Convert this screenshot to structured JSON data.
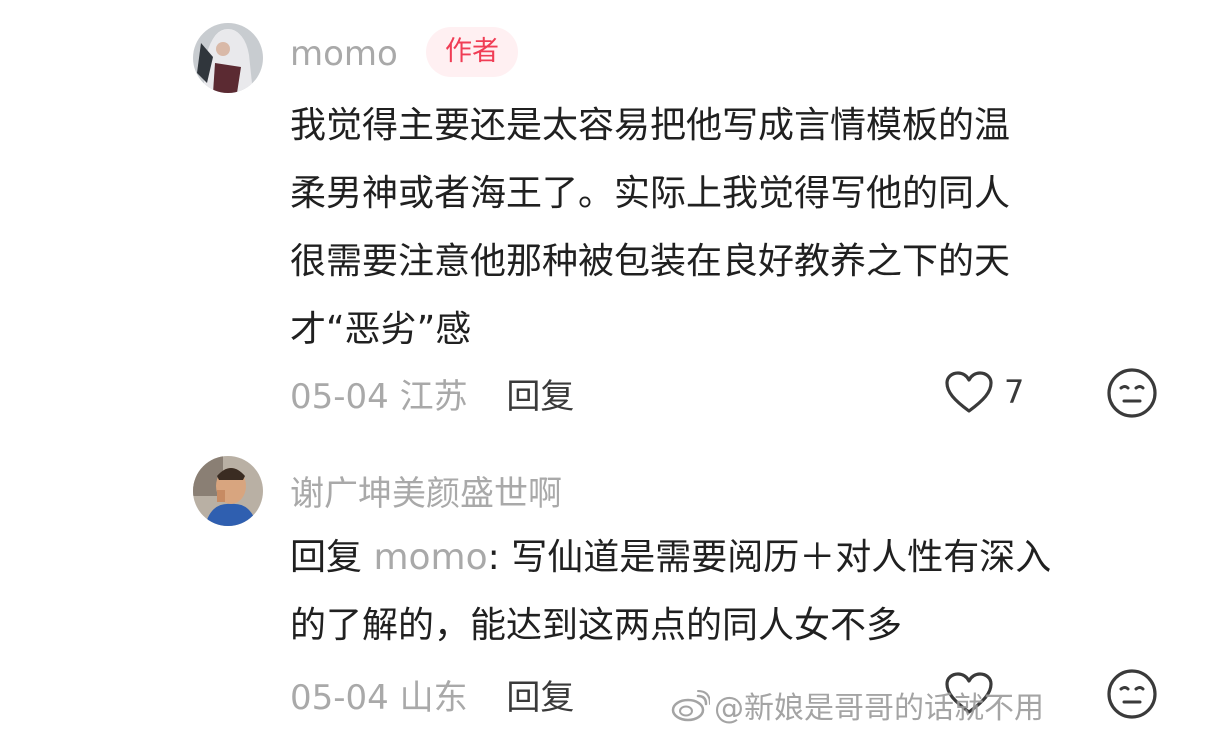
{
  "comments": [
    {
      "username": "momo",
      "badge": "作者",
      "text_lines": [
        "我觉得主要还是太容易把他写成言情模板的温",
        "柔男神或者海王了。实际上我觉得写他的同人",
        "很需要注意他那种被包装在良好教养之下的天",
        "才“恶劣”感"
      ],
      "date": "05-04",
      "location": "江苏",
      "reply_label": "回复",
      "like_count": "7"
    },
    {
      "username": "谢广坤美颜盛世啊",
      "reply_prefix": "回复 ",
      "reply_target": "momo",
      "reply_lines": [
        ": 写仙道是需要阅历＋对人性有深入",
        "的了解的，能达到这两点的同人女不多"
      ],
      "date": "05-04",
      "location": "山东",
      "reply_label": "回复"
    }
  ],
  "watermark": "@新娘是哥哥的话就不用"
}
